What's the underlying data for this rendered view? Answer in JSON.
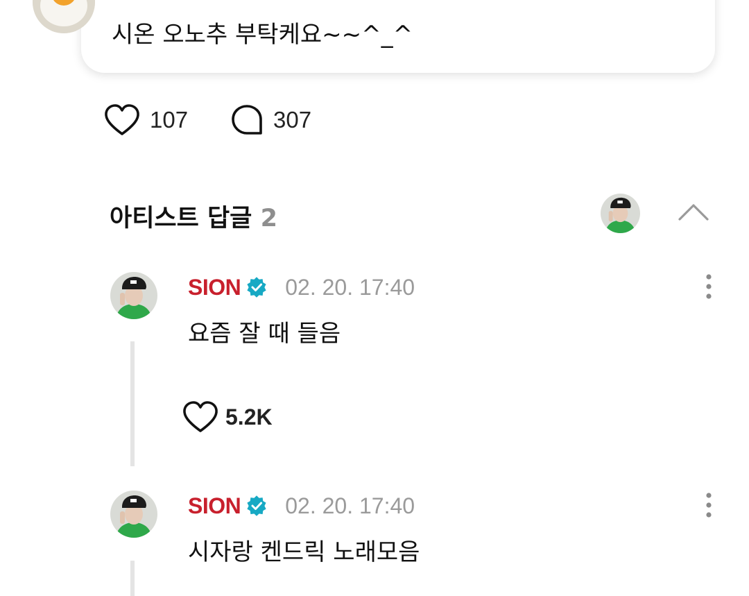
{
  "post": {
    "text": "시온 오노추 부탁케요~~^_^",
    "avatar_icon": "egg-character-avatar",
    "like_count": "107",
    "comment_count": "307"
  },
  "artist_replies": {
    "title": "아티스트 답글",
    "count": "2",
    "collapse_icon": "chevron-up-icon",
    "replies": [
      {
        "author": "SION",
        "verified": true,
        "timestamp": "02. 20. 17:40",
        "text": "요즘 잘 때 들음",
        "like_count": "5.2K"
      },
      {
        "author": "SION",
        "verified": true,
        "timestamp": "02. 20. 17:40",
        "text": "시자랑 켄드릭 노래모음"
      }
    ]
  },
  "colors": {
    "artist_name": "#c8202d",
    "verified_badge": "#17a9c4",
    "timestamp": "#9a9a9a",
    "count_gray": "#8e8e8e",
    "thread_line": "#e4e4e4"
  }
}
